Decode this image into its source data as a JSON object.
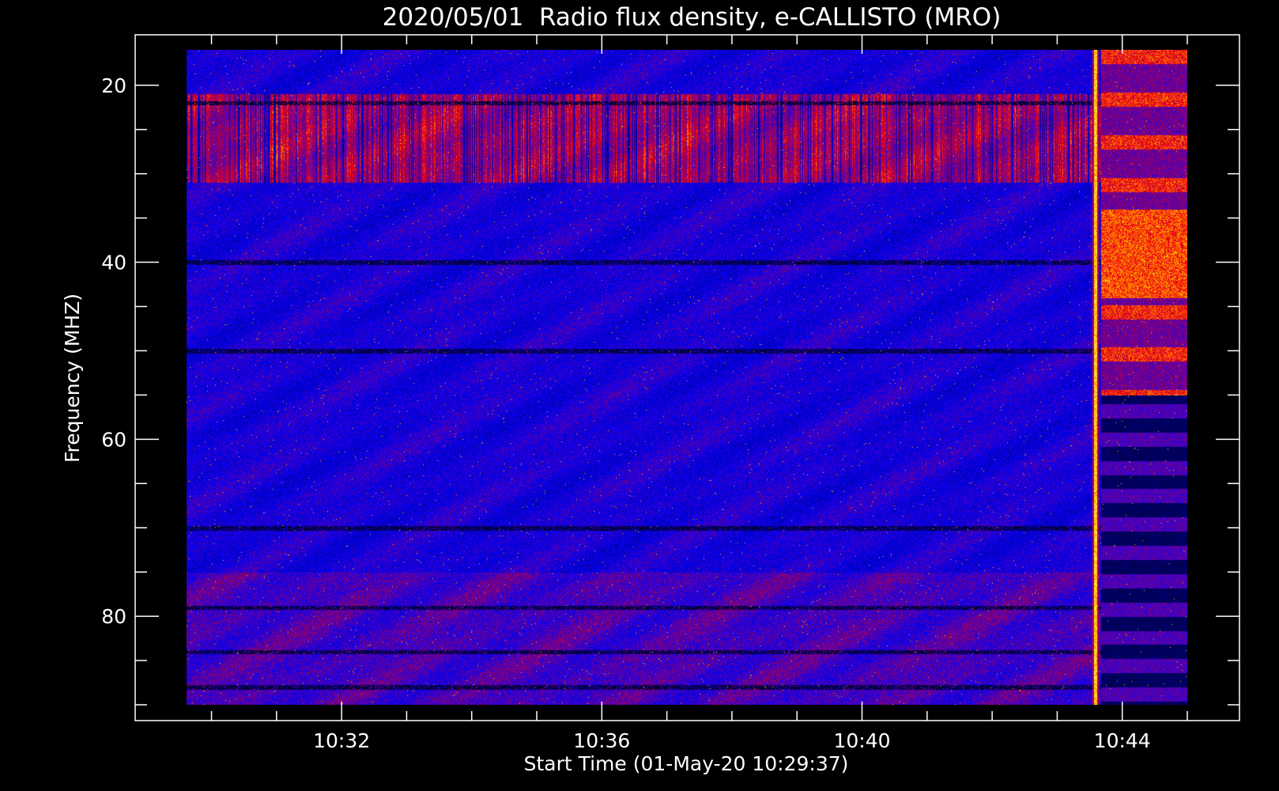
{
  "chart_data": {
    "type": "heatmap",
    "title": "2020/05/01  Radio flux density, e-CALLISTO (MRO)",
    "xlabel": "Start Time (01-May-20 10:29:37)",
    "ylabel": "Frequency (MHZ)",
    "x_axis": {
      "major_ticks": [
        "10:32",
        "10:36",
        "10:40",
        "10:44"
      ],
      "major_minutes": [
        32,
        36,
        40,
        44
      ],
      "minor_step_minutes": 1,
      "range_minutes": [
        29.6167,
        45.0
      ]
    },
    "y_axis": {
      "major_ticks": [
        "20",
        "40",
        "60",
        "80"
      ],
      "major_values": [
        20,
        40,
        60,
        80
      ],
      "minor_step": 5,
      "range": [
        16.0,
        90.0
      ],
      "inverted": true
    },
    "grid": false,
    "colormap": [
      "#000000",
      "#0000ff",
      "#ff0000",
      "#ffff00",
      "#ffffff"
    ],
    "features": {
      "burst_vertical_line_time": "10:43:35",
      "strong_band_MHz": [
        21,
        31
      ],
      "horizontal_lines_MHz": [
        22,
        40,
        50,
        70,
        79,
        84,
        88
      ],
      "interference_segment_after": "10:43:40"
    }
  }
}
